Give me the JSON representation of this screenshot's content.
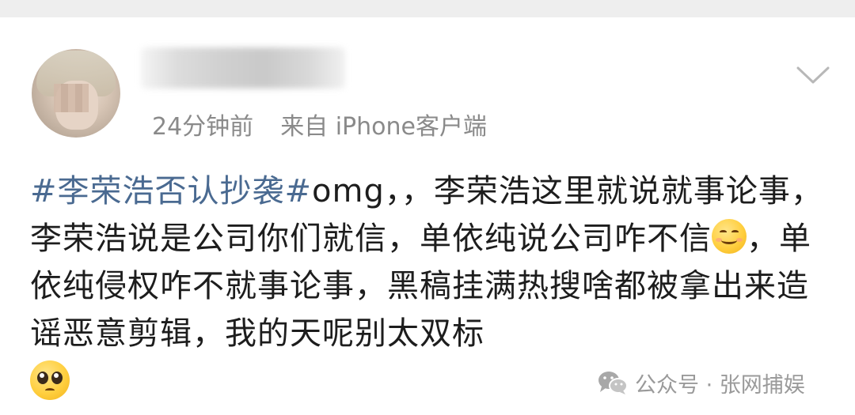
{
  "post": {
    "time": "24分钟前",
    "source": "来自 iPhone客户端",
    "segments": [
      {
        "type": "hashtag",
        "text": "#李荣浩否认抄袭#"
      },
      {
        "type": "text",
        "text": "omg，，李荣浩这里就说就事论事，李荣浩说是公司你们就信，单依纯说公司咋不信"
      },
      {
        "type": "emoji",
        "name": "smile-emoji"
      },
      {
        "type": "text",
        "text": "，单依纯侵权咋不就事论事，黑稿挂满热搜啥都被拿出来造谣恶意剪辑，我的天呢别太双标"
      }
    ],
    "trailing_emoji": "pleading-face-emoji"
  },
  "watermark": {
    "icon": "wechat-icon",
    "text": "公众号 · 张网捕娱"
  },
  "colors": {
    "hashtag": "#4a6a91",
    "meta_text": "#8a8a8a",
    "body_text": "#1d1d1d",
    "top_strip": "#eeeeee"
  }
}
